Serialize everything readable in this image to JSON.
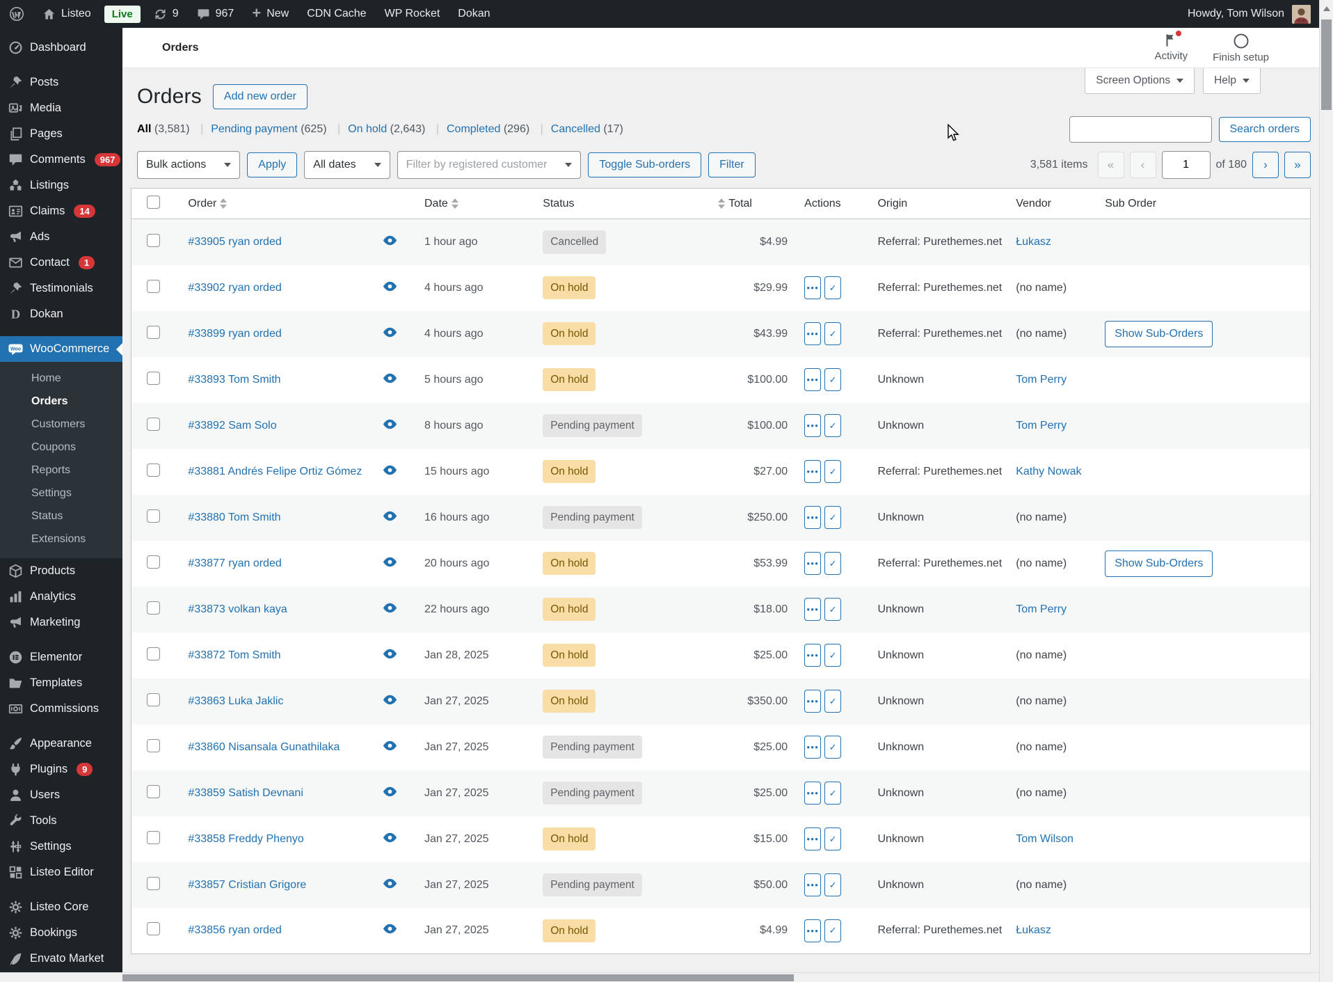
{
  "admin_bar": {
    "site_name": "Listeo",
    "live_badge": "Live",
    "update_count": "9",
    "comment_count": "967",
    "new_label": "New",
    "cdn_cache_label": "CDN Cache",
    "wp_rocket_label": "WP Rocket",
    "dokan_label": "Dokan",
    "howdy": "Howdy, Tom Wilson"
  },
  "sidebar": {
    "items_top": [
      {
        "label": "Dashboard",
        "icon": "gauge"
      },
      {
        "label": "Posts",
        "icon": "pin",
        "gap": true
      },
      {
        "label": "Media",
        "icon": "media"
      },
      {
        "label": "Pages",
        "icon": "pages"
      },
      {
        "label": "Comments",
        "icon": "comments",
        "badge": "967"
      },
      {
        "label": "Listings",
        "icon": "listings"
      },
      {
        "label": "Claims",
        "icon": "claims",
        "badge": "14"
      },
      {
        "label": "Ads",
        "icon": "megaphone"
      },
      {
        "label": "Contact",
        "icon": "envelope",
        "badge": "1"
      },
      {
        "label": "Testimonials",
        "icon": "pin"
      },
      {
        "label": "Dokan",
        "icon": "dokan"
      }
    ],
    "woocommerce_label": "WooCommerce",
    "submenu": [
      {
        "label": "Home"
      },
      {
        "label": "Orders",
        "current": true
      },
      {
        "label": "Customers"
      },
      {
        "label": "Coupons"
      },
      {
        "label": "Reports"
      },
      {
        "label": "Settings"
      },
      {
        "label": "Status"
      },
      {
        "label": "Extensions"
      }
    ],
    "items_bottom": [
      {
        "label": "Products",
        "icon": "box"
      },
      {
        "label": "Analytics",
        "icon": "bars"
      },
      {
        "label": "Marketing",
        "icon": "megaphone"
      },
      {
        "label": "Elementor",
        "icon": "elementor",
        "gap": true
      },
      {
        "label": "Templates",
        "icon": "folder"
      },
      {
        "label": "Commissions",
        "icon": "commissions"
      },
      {
        "label": "Appearance",
        "icon": "brush",
        "gap": true
      },
      {
        "label": "Plugins",
        "icon": "plug",
        "badge": "9"
      },
      {
        "label": "Users",
        "icon": "user"
      },
      {
        "label": "Tools",
        "icon": "wrench"
      },
      {
        "label": "Settings",
        "icon": "sliders"
      },
      {
        "label": "Listeo Editor",
        "icon": "grid"
      },
      {
        "label": "Listeo Core",
        "icon": "gear",
        "gap": true
      },
      {
        "label": "Bookings",
        "icon": "gear"
      },
      {
        "label": "Envato Market",
        "icon": "leaf"
      }
    ]
  },
  "header": {
    "page_title": "Orders",
    "activity_label": "Activity",
    "finish_setup_label": "Finish setup",
    "screen_options_label": "Screen Options",
    "help_label": "Help"
  },
  "content": {
    "heading": "Orders",
    "add_new_label": "Add new order",
    "views": [
      {
        "label": "All",
        "count": "(3,581)",
        "current": true
      },
      {
        "label": "Pending payment",
        "count": "(625)"
      },
      {
        "label": "On hold",
        "count": "(2,643)"
      },
      {
        "label": "Completed",
        "count": "(296)"
      },
      {
        "label": "Cancelled",
        "count": "(17)"
      }
    ],
    "search_button_label": "Search orders",
    "toolbar": {
      "bulk_actions": "Bulk actions",
      "apply": "Apply",
      "all_dates": "All dates",
      "customer_filter": "Filter by registered customer",
      "toggle_sub_orders": "Toggle Sub-orders",
      "filter": "Filter"
    },
    "pagination": {
      "items_count": "3,581 items",
      "first": "«",
      "prev": "‹",
      "page": "1",
      "of": "of 180",
      "next": "›",
      "last": "»"
    }
  },
  "table": {
    "columns": {
      "order": "Order",
      "date": "Date",
      "status": "Status",
      "total": "Total",
      "actions": "Actions",
      "origin": "Origin",
      "vendor": "Vendor",
      "sub_order": "Sub Order"
    },
    "show_sub_orders_label": "Show Sub-Orders",
    "rows": [
      {
        "order": "#33905 ryan orded",
        "date": "1 hour ago",
        "status": "Cancelled",
        "status_key": "cancelled",
        "total": "$4.99",
        "has_actions": false,
        "origin": "Referral: Purethemes.net",
        "vendor": "Łukasz",
        "vendor_link": true,
        "sub_order": false
      },
      {
        "order": "#33902 ryan orded",
        "date": "4 hours ago",
        "status": "On hold",
        "status_key": "on-hold",
        "total": "$29.99",
        "has_actions": true,
        "origin": "Referral: Purethemes.net",
        "vendor": "(no name)",
        "vendor_link": false,
        "sub_order": false
      },
      {
        "order": "#33899 ryan orded",
        "date": "4 hours ago",
        "status": "On hold",
        "status_key": "on-hold",
        "total": "$43.99",
        "has_actions": true,
        "origin": "Referral: Purethemes.net",
        "vendor": "(no name)",
        "vendor_link": false,
        "sub_order": true
      },
      {
        "order": "#33893 Tom Smith",
        "date": "5 hours ago",
        "status": "On hold",
        "status_key": "on-hold",
        "total": "$100.00",
        "has_actions": true,
        "origin": "Unknown",
        "vendor": "Tom Perry",
        "vendor_link": true,
        "sub_order": false
      },
      {
        "order": "#33892 Sam Solo",
        "date": "8 hours ago",
        "status": "Pending payment",
        "status_key": "pending",
        "total": "$100.00",
        "has_actions": true,
        "origin": "Unknown",
        "vendor": "Tom Perry",
        "vendor_link": true,
        "sub_order": false
      },
      {
        "order": "#33881 Andrés Felipe Ortiz Gómez",
        "date": "15 hours ago",
        "status": "On hold",
        "status_key": "on-hold",
        "total": "$27.00",
        "has_actions": true,
        "origin": "Referral: Purethemes.net",
        "vendor": "Kathy Nowak",
        "vendor_link": true,
        "sub_order": false
      },
      {
        "order": "#33880 Tom Smith",
        "date": "16 hours ago",
        "status": "Pending payment",
        "status_key": "pending",
        "total": "$250.00",
        "has_actions": true,
        "origin": "Unknown",
        "vendor": "(no name)",
        "vendor_link": false,
        "sub_order": false
      },
      {
        "order": "#33877 ryan orded",
        "date": "20 hours ago",
        "status": "On hold",
        "status_key": "on-hold",
        "total": "$53.99",
        "has_actions": true,
        "origin": "Referral: Purethemes.net",
        "vendor": "(no name)",
        "vendor_link": false,
        "sub_order": true
      },
      {
        "order": "#33873 volkan kaya",
        "date": "22 hours ago",
        "status": "On hold",
        "status_key": "on-hold",
        "total": "$18.00",
        "has_actions": true,
        "origin": "Unknown",
        "vendor": "Tom Perry",
        "vendor_link": true,
        "sub_order": false
      },
      {
        "order": "#33872 Tom Smith",
        "date": "Jan 28, 2025",
        "status": "On hold",
        "status_key": "on-hold",
        "total": "$25.00",
        "has_actions": true,
        "origin": "Unknown",
        "vendor": "(no name)",
        "vendor_link": false,
        "sub_order": false
      },
      {
        "order": "#33863 Luka Jaklic",
        "date": "Jan 27, 2025",
        "status": "On hold",
        "status_key": "on-hold",
        "total": "$350.00",
        "has_actions": true,
        "origin": "Unknown",
        "vendor": "(no name)",
        "vendor_link": false,
        "sub_order": false
      },
      {
        "order": "#33860 Nisansala Gunathilaka",
        "date": "Jan 27, 2025",
        "status": "Pending payment",
        "status_key": "pending",
        "total": "$25.00",
        "has_actions": true,
        "origin": "Unknown",
        "vendor": "(no name)",
        "vendor_link": false,
        "sub_order": false
      },
      {
        "order": "#33859 Satish Devnani",
        "date": "Jan 27, 2025",
        "status": "Pending payment",
        "status_key": "pending",
        "total": "$25.00",
        "has_actions": true,
        "origin": "Unknown",
        "vendor": "(no name)",
        "vendor_link": false,
        "sub_order": false
      },
      {
        "order": "#33858 Freddy Phenyo",
        "date": "Jan 27, 2025",
        "status": "On hold",
        "status_key": "on-hold",
        "total": "$15.00",
        "has_actions": true,
        "origin": "Unknown",
        "vendor": "Tom Wilson",
        "vendor_link": true,
        "sub_order": false
      },
      {
        "order": "#33857 Cristian Grigore",
        "date": "Jan 27, 2025",
        "status": "Pending payment",
        "status_key": "pending",
        "total": "$50.00",
        "has_actions": true,
        "origin": "Unknown",
        "vendor": "(no name)",
        "vendor_link": false,
        "sub_order": false
      },
      {
        "order": "#33856 ryan orded",
        "date": "Jan 27, 2025",
        "status": "On hold",
        "status_key": "on-hold",
        "total": "$4.99",
        "has_actions": true,
        "origin": "Referral: Purethemes.net",
        "vendor": "Łukasz",
        "vendor_link": true,
        "sub_order": false
      }
    ]
  },
  "colors": {
    "accent_blue": "#2271b1",
    "sidebar_bg": "#1d2327",
    "on_hold_badge_bg": "#f8dda7",
    "pending_badge_bg": "#e5e5e5",
    "cancelled_badge_bg": "#e5e5e5",
    "notification_red": "#d63638",
    "live_green": "#0a7a1e"
  }
}
